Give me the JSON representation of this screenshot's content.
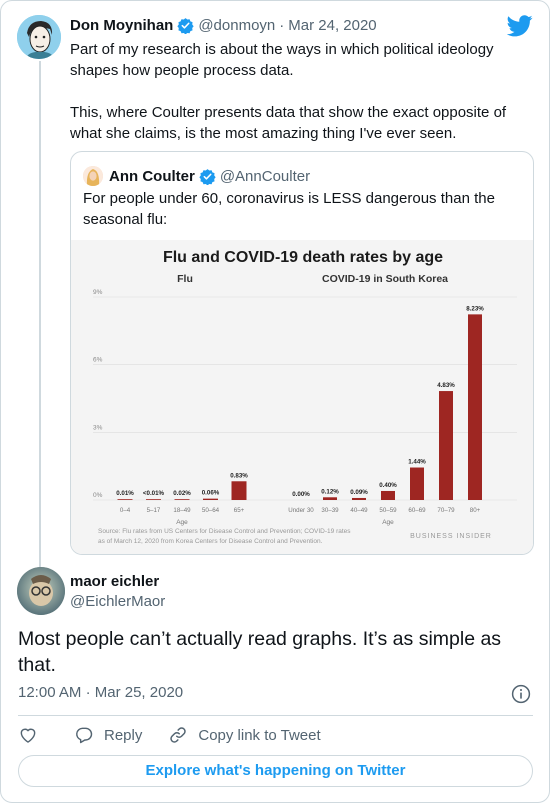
{
  "tweet1": {
    "name": "Don Moynihan",
    "handle": "@donmoyn",
    "separator": "·",
    "date": "Mar 24, 2020",
    "text": "Part of my research is about the ways in which political ideology shapes how people process data.\n\nThis, where Coulter presents data that show the exact opposite of what she claims, is the most amazing thing I've ever seen."
  },
  "quote": {
    "name": "Ann Coulter",
    "handle": "@AnnCoulter",
    "text": "For people under 60, coronavirus is LESS dangerous than the seasonal flu:"
  },
  "chart_data": [
    {
      "type": "bar",
      "title": "Flu and COVID-19 death rates by age",
      "subtitle": "Flu",
      "xlabel": "Age",
      "ylim": [
        0,
        9
      ],
      "ytick_labels": [
        "9%",
        "6%",
        "3%",
        "0%"
      ],
      "categories": [
        "0–4",
        "5–17",
        "18–49",
        "50–64",
        "65+"
      ],
      "values": [
        0.01,
        0.01,
        0.02,
        0.06,
        0.83
      ],
      "value_labels": [
        "0.01%",
        "<0.01%",
        "0.02%",
        "0.06%",
        "0.83%"
      ],
      "bar_color": "#9e2622"
    },
    {
      "type": "bar",
      "subtitle": "COVID-19 in South Korea",
      "xlabel": "Age",
      "ylim": [
        0,
        9
      ],
      "categories": [
        "Under 30",
        "30–39",
        "40–49",
        "50–59",
        "60–69",
        "70–79",
        "80+"
      ],
      "values": [
        0.0,
        0.12,
        0.09,
        0.4,
        1.44,
        4.83,
        8.23
      ],
      "value_labels": [
        "0.00%",
        "0.12%",
        "0.09%",
        "0.40%",
        "1.44%",
        "4.83%",
        "8.23%"
      ],
      "bar_color": "#9e2622"
    }
  ],
  "chart_source": {
    "line1": "Source: Flu rates from US Centers for Disease Control and Prevention; COVID-19 rates",
    "line2": "as of March 12, 2020 from Korea Centers for Disease Control and Prevention.",
    "brand": "BUSINESS INSIDER"
  },
  "tweet2": {
    "name": "maor eichler",
    "handle": "@EichlerMaor",
    "text": "Most people can’t actually read graphs. It’s as simple as that.",
    "time": "12:00 AM",
    "separator": "·",
    "date": "Mar 25, 2020"
  },
  "actions": {
    "reply": "Reply",
    "copy": "Copy link to Tweet"
  },
  "explore": "Explore what's happening on Twitter",
  "colors": {
    "accent": "#1d9bf0",
    "bar": "#9e2622",
    "text": "#0f1419",
    "muted": "#536471"
  },
  "icons": [
    "twitter-bird-icon",
    "verified-badge-icon",
    "info-icon",
    "heart-icon",
    "reply-icon",
    "link-icon"
  ]
}
